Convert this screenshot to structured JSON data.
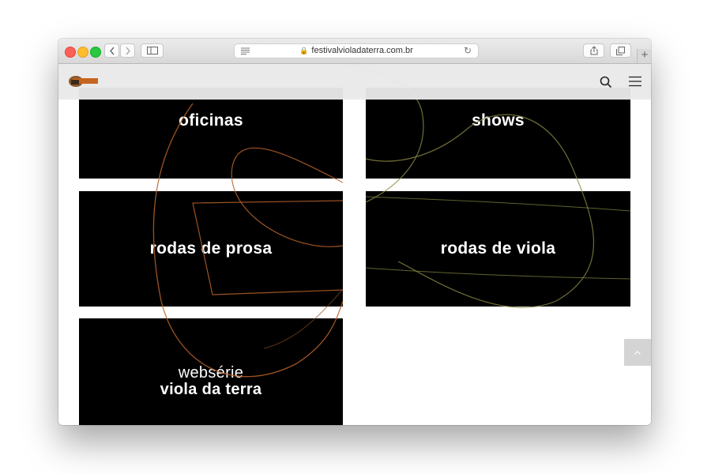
{
  "browser": {
    "url": "festivalvioladaterra.com.br",
    "icons": [
      "back-icon",
      "forward-icon",
      "sidebar-icon",
      "reader-icon",
      "lock-icon",
      "reload-icon",
      "share-icon",
      "tabs-icon",
      "new-tab-icon"
    ]
  },
  "header": {
    "icons": [
      "search-icon",
      "hamburger-menu-icon"
    ]
  },
  "tiles": {
    "oficinas": "oficinas",
    "shows": "shows",
    "rodas_prosa": "rodas de prosa",
    "rodas_viola": "rodas de viola",
    "webserie_line1": "websérie",
    "webserie_line2": "viola da terra"
  },
  "colors": {
    "tile_bg": "#000000",
    "accent_orange": "#b8632a",
    "accent_olive": "#8c8a45"
  }
}
